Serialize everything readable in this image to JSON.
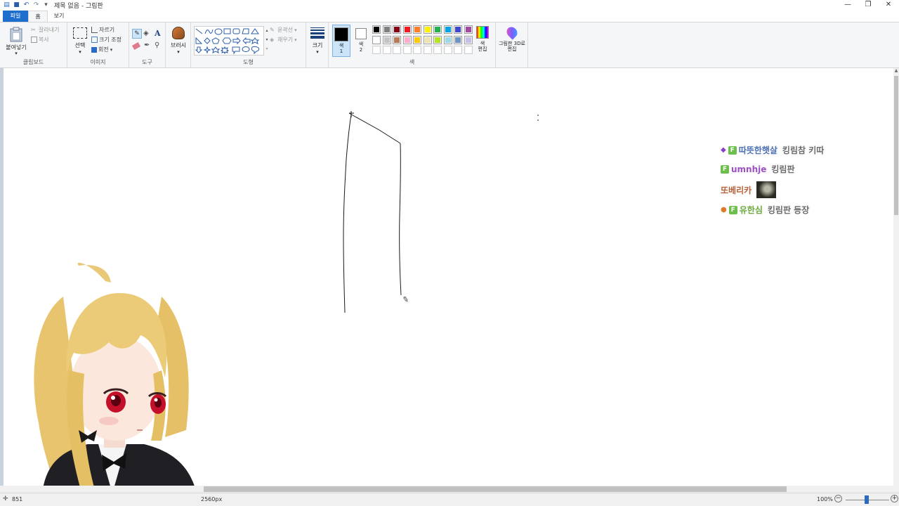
{
  "window": {
    "title": "제목 없음 - 그림판",
    "controls": {
      "minimize": "—",
      "restore": "❐",
      "close": "✕"
    }
  },
  "quick_access": [
    "save-icon",
    "undo-icon",
    "redo-icon",
    "customize-icon"
  ],
  "tabs": [
    {
      "label": "파일",
      "active": false
    },
    {
      "label": "홈",
      "active": true
    },
    {
      "label": "보기",
      "active": false
    }
  ],
  "ribbon": {
    "clipboard": {
      "label": "클립보드",
      "paste": "붙여넣기",
      "cut": "잘라내기",
      "copy": "복사"
    },
    "image": {
      "label": "이미지",
      "select": "선택",
      "crop": "자르기",
      "resize": "크기 조정",
      "rotate": "회전"
    },
    "tools": {
      "label": "도구"
    },
    "brushes": {
      "label": "브러시"
    },
    "shapes": {
      "label": "도형",
      "outline": "윤곽선",
      "fill": "채우기"
    },
    "size": {
      "label": "크기"
    },
    "colors": {
      "label": "색",
      "color1": "색\n1",
      "color2": "색\n2",
      "edit_colors": "색\n편집",
      "color1_value": "#000000",
      "color2_value": "#ffffff",
      "palette_row1": [
        "#000000",
        "#7f7f7f",
        "#880015",
        "#ed1c24",
        "#ff7f27",
        "#fff200",
        "#22b14c",
        "#00a2e8",
        "#3f48cc",
        "#a349a4"
      ],
      "palette_row2": [
        "#ffffff",
        "#c3c3c3",
        "#b97a57",
        "#ffaec9",
        "#ffc90e",
        "#efe4b0",
        "#b5e61d",
        "#99d9ea",
        "#7092be",
        "#c8bfe7"
      ],
      "palette_row3": [
        "#ffffff",
        "#ffffff",
        "#ffffff",
        "#ffffff",
        "#ffffff",
        "#ffffff",
        "#ffffff",
        "#ffffff",
        "#ffffff",
        "#ffffff"
      ]
    },
    "paint3d": {
      "label": "그림판 3D로 편집"
    }
  },
  "chat": [
    {
      "icons": [
        "gem-icon",
        "fan-badge"
      ],
      "user": "따뜻한햇살",
      "user_color": "#4a6fb5",
      "message": "킹림참 키따"
    },
    {
      "icons": [
        "fan-badge"
      ],
      "user": "umnhje",
      "user_color": "#9b4fc2",
      "message": "킹림판"
    },
    {
      "icons": [],
      "user": "또베리카",
      "user_color": "#b5633a",
      "message": ""
    },
    {
      "icons": [
        "pumpkin-icon",
        "fan-badge"
      ],
      "user": "유한심",
      "user_color": "#6aa83a",
      "message": "킹림판 등장"
    }
  ],
  "fan_badge_text": "F",
  "statusbar": {
    "position": "851",
    "canvas_size": "2560px",
    "zoom": "100%"
  }
}
